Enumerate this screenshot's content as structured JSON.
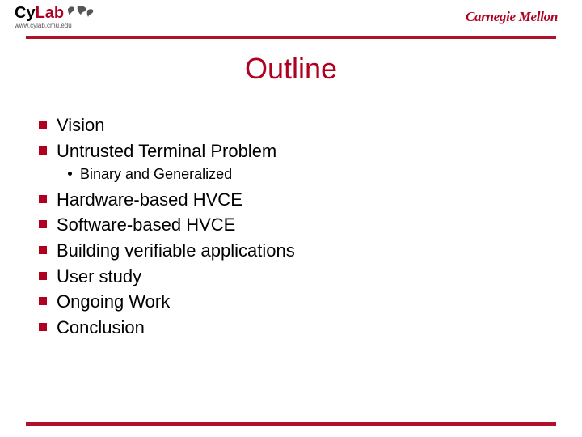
{
  "header": {
    "left_logo_primary_cy": "Cy",
    "left_logo_primary_lab": "Lab",
    "left_logo_sub": "www.cylab.cmu.edu",
    "right_brand": "Carnegie Mellon"
  },
  "slide": {
    "title": "Outline",
    "bullets": [
      "Vision",
      "Untrusted Terminal Problem",
      "Hardware-based HVCE",
      "Software-based HVCE",
      "Building verifiable applications",
      "User study",
      "Ongoing Work",
      "Conclusion"
    ],
    "sub_after_index_1": "Binary and Generalized"
  },
  "colors": {
    "accent": "#b00020"
  }
}
